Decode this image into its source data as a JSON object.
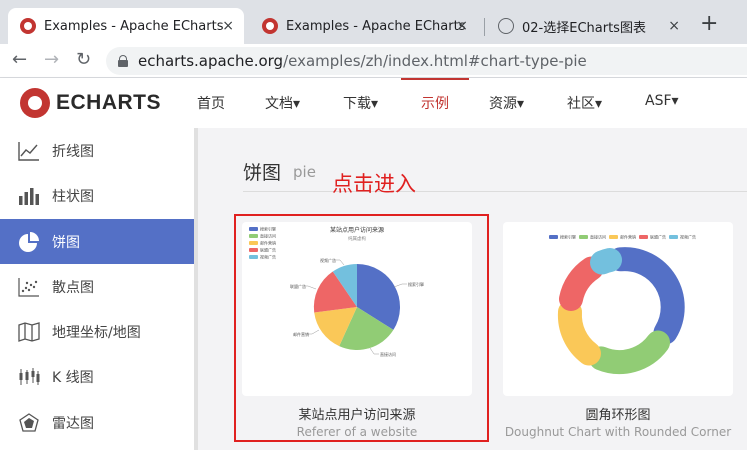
{
  "browser": {
    "tabs": [
      {
        "title": "Examples - Apache ECharts"
      },
      {
        "title": "Examples - Apache ECharts"
      },
      {
        "title": "02-选择ECharts图表"
      }
    ],
    "new_tab_label": "+",
    "close_label": "×",
    "back_glyph": "←",
    "forward_glyph": "→",
    "reload_glyph": "↻",
    "url_host": "echarts.apache.org",
    "url_path": "/examples/zh/index.html#chart-type-pie"
  },
  "site": {
    "logo_text": "ECHARTS",
    "nav": [
      {
        "label": "首页"
      },
      {
        "label": "文档▾"
      },
      {
        "label": "下载▾"
      },
      {
        "label": "示例"
      },
      {
        "label": "资源▾"
      },
      {
        "label": "社区▾"
      },
      {
        "label": "ASF▾"
      }
    ]
  },
  "sidebar": {
    "items": [
      {
        "label": "折线图",
        "icon": "line-chart-icon"
      },
      {
        "label": "柱状图",
        "icon": "bar-chart-icon"
      },
      {
        "label": "饼图",
        "icon": "pie-chart-icon",
        "active": true
      },
      {
        "label": "散点图",
        "icon": "scatter-chart-icon"
      },
      {
        "label": "地理坐标/地图",
        "icon": "map-icon"
      },
      {
        "label": "K 线图",
        "icon": "candlestick-icon"
      },
      {
        "label": "雷达图",
        "icon": "radar-icon"
      }
    ]
  },
  "section": {
    "title": "饼图",
    "subtitle": "pie",
    "annotation": "点击进入"
  },
  "examples": [
    {
      "name": "某站点用户访问来源",
      "subtitle": "Referer of a website",
      "thumb_title": "某站点用户访问来源",
      "thumb_subtitle": "纯属虚构",
      "legend": [
        "搜索引擎",
        "直接访问",
        "邮件营销",
        "联盟广告",
        "视频广告"
      ],
      "slice_labels": [
        "搜索引擎",
        "直接访问",
        "邮件营销",
        "联盟广告",
        "视频广告"
      ]
    },
    {
      "name": "圆角环形图",
      "subtitle": "Doughnut Chart with Rounded Corner",
      "legend": [
        "搜索引擎",
        "直接访问",
        "邮件营销",
        "联盟广告",
        "视频广告"
      ]
    }
  ],
  "colors": {
    "accent": "#5470c6",
    "brand_red": "#c23531",
    "annotation_red": "#e02020",
    "series": [
      "#5470c6",
      "#91cc75",
      "#fac858",
      "#ee6666",
      "#73c0de"
    ]
  }
}
